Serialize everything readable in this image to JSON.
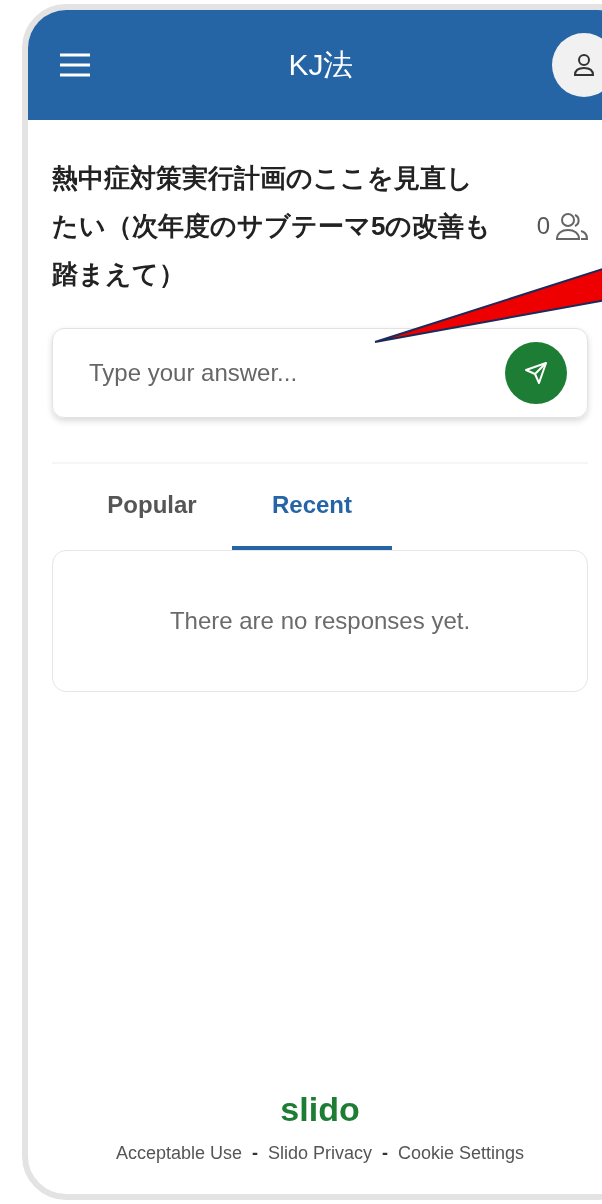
{
  "header": {
    "title": "KJ法"
  },
  "question": {
    "text": "熱中症対策実行計画のここを見直したい（次年度のサブテーマ5の改善も踏まえて）",
    "participants": "0"
  },
  "answer_field": {
    "placeholder": "Type your answer..."
  },
  "tabs": [
    {
      "label": "Popular",
      "selected": false
    },
    {
      "label": "Recent",
      "selected": true
    }
  ],
  "responses": {
    "empty_message": "There are no responses yet."
  },
  "footer": {
    "logo": "slido",
    "items": [
      {
        "kind": "link",
        "text": "Acceptable Use"
      },
      {
        "kind": "separator",
        "text": "-"
      },
      {
        "kind": "link",
        "text": "Slido Privacy"
      },
      {
        "kind": "separator",
        "text": "-"
      },
      {
        "kind": "link",
        "text": "Cookie Settings"
      }
    ]
  }
}
